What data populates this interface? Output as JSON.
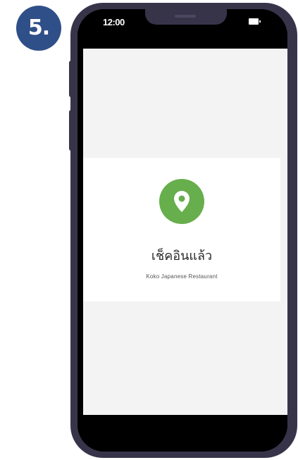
{
  "step": {
    "label": "5."
  },
  "status_bar": {
    "time": "12:00",
    "battery_icon": "battery-icon"
  },
  "checkin": {
    "icon": "location-pin-icon",
    "icon_color": "#67ae4c",
    "title": "เช็คอินแล้ว",
    "venue": "Koko Japanese Restaurant"
  },
  "colors": {
    "badge": "#2f4f88",
    "phone_frame": "#37344a",
    "screen_background": "#f3f3f4"
  }
}
